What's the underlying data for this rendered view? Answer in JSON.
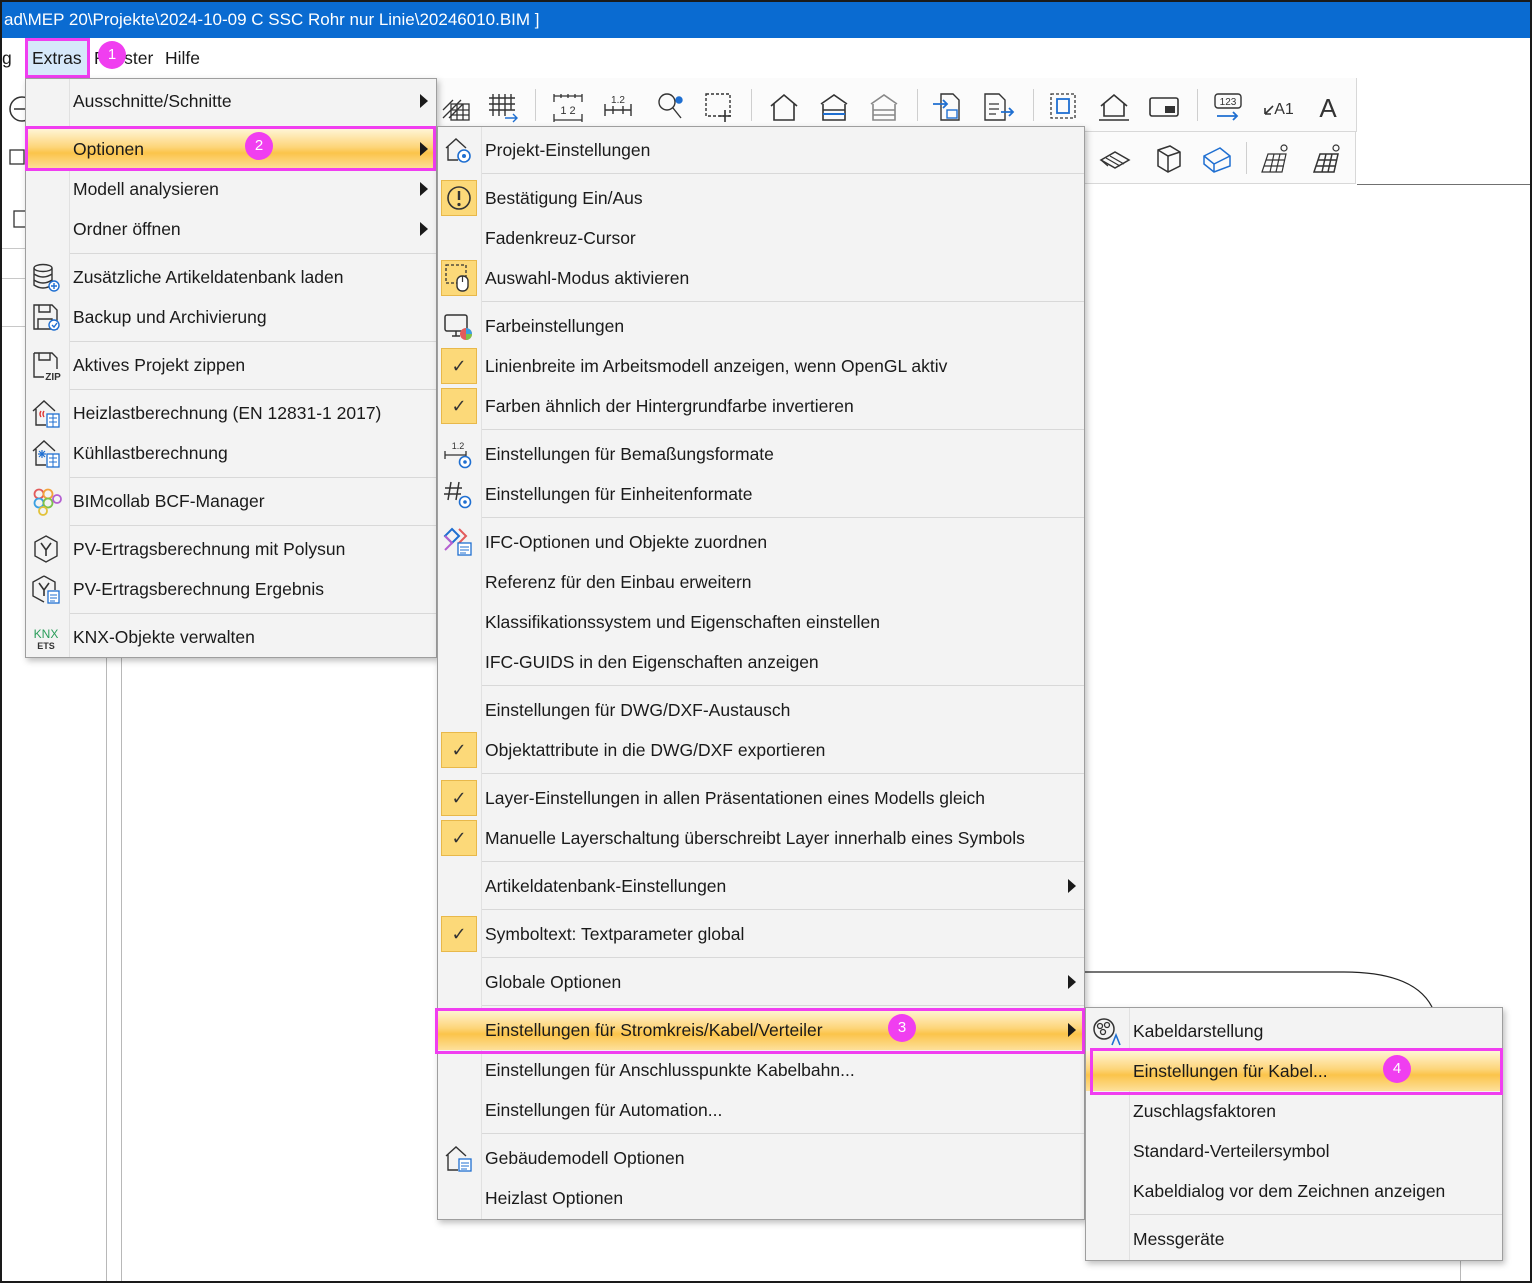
{
  "window": {
    "title": "ad\\MEP 20\\Projekte\\2024-10-09 C SSC Rohr nur Linie\\20246010.BIM ]"
  },
  "menubar": {
    "partial_left": "g",
    "extras": "Extras",
    "fenster": "Fenster",
    "hilfe": "Hilfe"
  },
  "annotations": {
    "step1": "1",
    "step2": "2",
    "step3": "3",
    "step4": "4",
    "highlight_color": "#f03ef0"
  },
  "extras_menu": {
    "items": [
      {
        "label": "Ausschnitte/Schnitte"
      },
      {
        "label": "Optionen"
      },
      {
        "label": "Modell analysieren"
      },
      {
        "label": "Ordner öffnen"
      },
      {
        "label": "Zusätzliche Artikeldatenbank laden"
      },
      {
        "label": "Backup und Archivierung"
      },
      {
        "label": "Aktives Projekt zippen"
      },
      {
        "label": "Heizlastberechnung (EN 12831-1 2017)"
      },
      {
        "label": "Kühllastberechnung"
      },
      {
        "label": "BIMcollab BCF-Manager"
      },
      {
        "label": "PV-Ertragsberechnung mit Polysun"
      },
      {
        "label": "PV-Ertragsberechnung Ergebnis"
      },
      {
        "label": "KNX-Objekte verwalten"
      }
    ]
  },
  "optionen_menu": {
    "items": [
      {
        "label": "Projekt-Einstellungen"
      },
      {
        "label": "Bestätigung Ein/Aus"
      },
      {
        "label": "Fadenkreuz-Cursor"
      },
      {
        "label": "Auswahl-Modus aktivieren"
      },
      {
        "label": "Farbeinstellungen"
      },
      {
        "label": "Linienbreite im Arbeitsmodell anzeigen, wenn OpenGL aktiv"
      },
      {
        "label": "Farben ähnlich der Hintergrundfarbe invertieren"
      },
      {
        "label": "Einstellungen für Bemaßungsformate"
      },
      {
        "label": "Einstellungen für Einheitenformate"
      },
      {
        "label": "IFC-Optionen und Objekte zuordnen"
      },
      {
        "label": "Referenz für den Einbau erweitern"
      },
      {
        "label": "Klassifikationssystem und Eigenschaften einstellen"
      },
      {
        "label": "IFC-GUIDS in den Eigenschaften anzeigen"
      },
      {
        "label": "Einstellungen für DWG/DXF-Austausch"
      },
      {
        "label": "Objektattribute in die DWG/DXF exportieren"
      },
      {
        "label": "Layer-Einstellungen in allen Präsentationen eines Modells gleich"
      },
      {
        "label": "Manuelle Layerschaltung überschreibt Layer innerhalb eines Symbols"
      },
      {
        "label": "Artikeldatenbank-Einstellungen"
      },
      {
        "label": "Symboltext: Textparameter global"
      },
      {
        "label": "Globale Optionen"
      },
      {
        "label": "Einstellungen für Stromkreis/Kabel/Verteiler"
      },
      {
        "label": "Einstellungen für Anschlusspunkte Kabelbahn..."
      },
      {
        "label": "Einstellungen für Automation..."
      },
      {
        "label": "Gebäudemodell Optionen"
      },
      {
        "label": "Heizlast Optionen"
      }
    ],
    "check_mark": "✓"
  },
  "kabel_menu": {
    "items": [
      {
        "label": "Kabeldarstellung"
      },
      {
        "label": "Einstellungen für Kabel..."
      },
      {
        "label": "Zuschlagsfaktoren"
      },
      {
        "label": "Standard-Verteilersymbol"
      },
      {
        "label": "Kabeldialog vor dem Zeichnen anzeigen"
      },
      {
        "label": "Messgeräte"
      }
    ]
  },
  "toolbar": {
    "icon_labels": [
      "1 2",
      "1.2",
      "123",
      "A1",
      "A"
    ]
  }
}
